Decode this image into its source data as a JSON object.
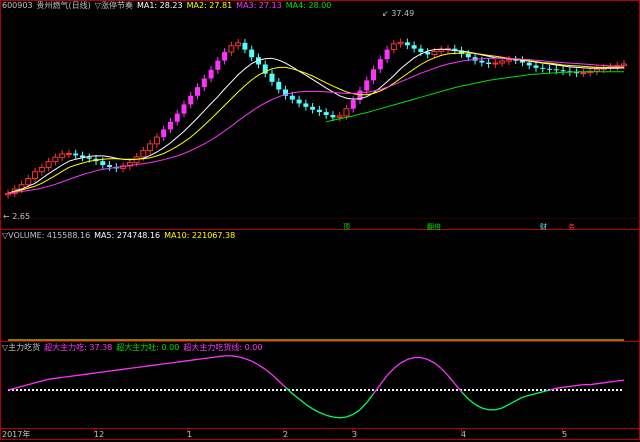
{
  "main_header": {
    "code": "600903",
    "name": "贵州燃气(日线)",
    "indicator": "▽涨停节奏",
    "ma1_label": "MA1: 28.23",
    "ma2_label": "MA2: 27.81",
    "ma3_label": "MA3: 27.13",
    "ma4_label": "MA4: 28.00"
  },
  "volume_header": {
    "name": "▽VOLUME: 415588.16",
    "ma5_label": "MA5: 274748.16",
    "ma10_label": "MA10: 221067.38"
  },
  "indicator_header": {
    "name": "▽主力吃货",
    "s1_label": "超大主力吃: 37.38",
    "s2_label": "超大主力吐: 0.00",
    "s3_label": "超大主力吃货线: 0.00"
  },
  "annotations": {
    "high": "37.49",
    "low": "2.65"
  },
  "markers": [
    "顶",
    "翻倍",
    "财",
    "务"
  ],
  "x_labels": [
    "2017年",
    "12",
    "1",
    "2",
    "3",
    "4",
    "5"
  ],
  "colors": {
    "up": "#ff3232",
    "down": "#54ffff",
    "limit_up": "#ff33ff",
    "ma1": "#ffffff",
    "ma2": "#ffff00",
    "ma3": "#ff33ff",
    "ma4": "#00e000",
    "frame": "#b40000"
  },
  "chart_data": [
    {
      "type": "candlestick",
      "title": "贵州燃气(日线)",
      "ylim": [
        -2,
        40
      ],
      "series": [
        {
          "name": "price",
          "values": [
            2.7,
            3.6,
            4.5,
            5.8,
            7.2,
            8.1,
            9.3,
            10.2,
            10.9,
            11.0,
            10.6,
            10.2,
            9.9,
            9.4,
            8.6,
            8.2,
            7.9,
            8.4,
            9.1,
            10.3,
            11.6,
            13.0,
            14.4,
            16.0,
            17.6,
            19.3,
            21.2,
            23.0,
            24.8,
            26.6,
            28.4,
            30.3,
            32.1,
            33.4,
            34.0,
            32.6,
            31.0,
            29.5,
            27.6,
            25.9,
            24.3,
            23.0,
            22.2,
            21.4,
            20.7,
            20.1,
            19.6,
            19.0,
            18.5,
            18.8,
            20.3,
            22.1,
            24.1,
            26.2,
            28.5,
            30.6,
            32.6,
            33.8,
            34.1,
            33.5,
            32.8,
            32.1,
            31.6,
            32.2,
            32.6,
            32.8,
            32.4,
            31.7,
            31.0,
            30.3,
            29.9,
            29.6,
            29.8,
            30.2,
            30.5,
            30.4,
            29.9,
            29.3,
            28.8,
            28.6,
            28.5,
            28.3,
            28.1,
            27.9,
            27.7,
            27.8,
            28.1,
            28.5,
            28.8,
            29.0,
            29.3,
            29.6
          ]
        },
        {
          "name": "MA1",
          "values": [
            2.7,
            3.2,
            3.6,
            4.2,
            4.8,
            5.8,
            6.8,
            7.7,
            8.6,
            9.4,
            9.8,
            10.1,
            10.4,
            10.5,
            10.5,
            10.3,
            10.0,
            9.8,
            9.7,
            9.8,
            10.0,
            10.6,
            11.3,
            12.2,
            13.2,
            14.4,
            15.6,
            17.0,
            18.4,
            19.9,
            21.4,
            22.8,
            24.4,
            25.9,
            27.4,
            28.6,
            29.7,
            30.4,
            30.7,
            30.8,
            30.4,
            29.8,
            29.0,
            28.1,
            27.3,
            26.4,
            25.5,
            24.6,
            23.8,
            23.0,
            22.5,
            22.3,
            22.4,
            22.8,
            23.6,
            24.7,
            25.9,
            27.2,
            28.6,
            29.8,
            30.9,
            31.7,
            32.3,
            32.6,
            32.7,
            32.6,
            32.4,
            32.3,
            32.1,
            31.8,
            31.5,
            31.2,
            30.9,
            30.8,
            30.7,
            30.6,
            30.4,
            30.2,
            30.0,
            29.8,
            29.6,
            29.4,
            29.2,
            29.0,
            28.9,
            28.8,
            28.7,
            28.7,
            28.7,
            28.7,
            28.7,
            28.8
          ]
        },
        {
          "name": "MA2",
          "values": [
            2.7,
            3.1,
            3.4,
            3.8,
            4.2,
            4.8,
            5.6,
            6.4,
            7.3,
            8.1,
            8.6,
            9.0,
            9.4,
            9.6,
            9.8,
            9.9,
            9.9,
            9.8,
            9.8,
            9.8,
            9.9,
            10.1,
            10.5,
            11.0,
            11.7,
            12.5,
            13.4,
            14.4,
            15.6,
            16.9,
            18.2,
            19.6,
            21.0,
            22.4,
            23.8,
            25.1,
            26.3,
            27.3,
            28.0,
            28.6,
            28.9,
            28.9,
            28.6,
            28.2,
            27.7,
            27.1,
            26.4,
            25.7,
            25.0,
            24.4,
            23.8,
            23.4,
            23.2,
            23.2,
            23.5,
            24.0,
            24.7,
            25.6,
            26.6,
            27.6,
            28.6,
            29.5,
            30.3,
            30.9,
            31.4,
            31.7,
            31.8,
            31.9,
            31.9,
            31.8,
            31.6,
            31.4,
            31.2,
            31.0,
            30.8,
            30.6,
            30.5,
            30.3,
            30.1,
            29.9,
            29.8,
            29.6,
            29.4,
            29.3,
            29.2,
            29.1,
            29.0,
            28.9,
            28.9,
            28.9,
            28.9,
            28.9
          ]
        },
        {
          "name": "MA3",
          "values": [
            2.7,
            2.9,
            3.1,
            3.3,
            3.5,
            3.8,
            4.2,
            4.6,
            5.1,
            5.6,
            6.1,
            6.6,
            7.0,
            7.4,
            7.7,
            7.9,
            8.1,
            8.3,
            8.5,
            8.7,
            8.9,
            9.1,
            9.4,
            9.7,
            10.1,
            10.5,
            11.0,
            11.6,
            12.3,
            13.0,
            13.8,
            14.7,
            15.7,
            16.7,
            17.8,
            18.8,
            19.8,
            20.7,
            21.5,
            22.2,
            22.8,
            23.3,
            23.6,
            23.8,
            23.9,
            23.9,
            23.9,
            23.8,
            23.7,
            23.6,
            23.5,
            23.5,
            23.6,
            23.7,
            24.0,
            24.3,
            24.8,
            25.3,
            25.9,
            26.5,
            27.1,
            27.7,
            28.2,
            28.7,
            29.2,
            29.6,
            29.9,
            30.2,
            30.4,
            30.6,
            30.7,
            30.8,
            30.8,
            30.8,
            30.8,
            30.7,
            30.6,
            30.5,
            30.4,
            30.3,
            30.1,
            30.0,
            29.9,
            29.8,
            29.7,
            29.6,
            29.5,
            29.4,
            29.3,
            29.2,
            29.1,
            29.1
          ]
        },
        {
          "name": "MA4",
          "values": [
            null,
            null,
            null,
            null,
            null,
            null,
            null,
            null,
            null,
            null,
            null,
            null,
            null,
            null,
            null,
            null,
            null,
            null,
            null,
            null,
            null,
            null,
            null,
            null,
            null,
            null,
            null,
            null,
            null,
            null,
            null,
            null,
            null,
            null,
            null,
            null,
            null,
            null,
            null,
            null,
            null,
            null,
            null,
            null,
            null,
            null,
            null,
            17.6,
            17.9,
            18.2,
            18.5,
            18.8,
            19.2,
            19.5,
            19.9,
            20.3,
            20.7,
            21.1,
            21.5,
            21.9,
            22.3,
            22.7,
            23.1,
            23.5,
            23.9,
            24.3,
            24.7,
            25.0,
            25.3,
            25.6,
            25.9,
            26.2,
            26.4,
            26.6,
            26.8,
            27.0,
            27.2,
            27.4,
            27.5,
            27.6,
            27.7,
            27.8,
            27.9,
            27.9,
            28.0,
            28.0,
            28.0,
            28.0,
            28.0,
            28.0,
            28.0,
            28.0
          ]
        }
      ]
    },
    {
      "type": "bar",
      "title": "VOLUME",
      "ylim": [
        0,
        500000
      ],
      "series": [
        {
          "name": "VOLUME",
          "values": [
            0,
            0,
            0,
            0,
            0,
            0,
            0,
            0,
            0,
            0,
            0,
            0,
            0,
            0,
            0,
            0,
            0,
            0,
            0,
            0,
            0,
            0,
            0,
            0,
            0,
            0,
            0,
            0,
            0,
            0,
            0,
            0,
            0,
            0,
            0,
            0,
            0,
            0,
            0,
            0,
            0,
            0,
            0,
            0,
            0,
            0,
            0,
            0,
            0,
            0,
            0,
            0,
            0,
            0,
            0,
            0,
            0,
            0,
            0,
            0,
            0,
            0,
            0,
            0,
            0,
            0,
            0,
            0,
            0,
            0,
            0,
            0,
            0,
            0,
            0,
            0,
            0,
            0,
            0,
            0,
            0,
            0,
            0,
            0,
            0,
            0,
            0,
            0,
            0,
            0,
            0,
            0
          ]
        },
        {
          "name": "MA5",
          "values": [
            0,
            0,
            0,
            0,
            0,
            0,
            0,
            0,
            0,
            0,
            0,
            0,
            0,
            0,
            0,
            0,
            0,
            0,
            0,
            0,
            0,
            0,
            0,
            0,
            0,
            0,
            0,
            0,
            0,
            0,
            0,
            0,
            0,
            0,
            0,
            0,
            0,
            0,
            0,
            0,
            0,
            0,
            0,
            0,
            0,
            0,
            0,
            0,
            0,
            0,
            0,
            0,
            0,
            0,
            0,
            0,
            0,
            0,
            0,
            0,
            0,
            0,
            0,
            0,
            0,
            0,
            0,
            0,
            0,
            0,
            0,
            0,
            0,
            0,
            0,
            0,
            0,
            0,
            0,
            0,
            0,
            0,
            0,
            0,
            0,
            0,
            0,
            0,
            0,
            0,
            0,
            0
          ]
        },
        {
          "name": "MA10",
          "values": [
            0,
            0,
            0,
            0,
            0,
            0,
            0,
            0,
            0,
            0,
            0,
            0,
            0,
            0,
            0,
            0,
            0,
            0,
            0,
            0,
            0,
            0,
            0,
            0,
            0,
            0,
            0,
            0,
            0,
            0,
            0,
            0,
            0,
            0,
            0,
            0,
            0,
            0,
            0,
            0,
            0,
            0,
            0,
            0,
            0,
            0,
            0,
            0,
            0,
            0,
            0,
            0,
            0,
            0,
            0,
            0,
            0,
            0,
            0,
            0,
            0,
            0,
            0,
            0,
            0,
            0,
            0,
            0,
            0,
            0,
            0,
            0,
            0,
            0,
            0,
            0,
            0,
            0,
            0,
            0,
            0,
            0,
            0,
            0,
            0,
            0,
            0,
            0,
            0,
            0,
            0,
            0
          ]
        }
      ]
    },
    {
      "type": "line",
      "title": "主力吃货",
      "ylim": [
        -40,
        40
      ],
      "series": [
        {
          "name": "超大主力吃",
          "values": [
            0,
            2,
            4,
            6,
            8,
            10,
            12,
            13,
            14,
            15,
            16,
            17,
            18,
            19,
            20,
            21,
            22,
            23,
            24,
            25,
            26,
            27,
            28,
            29,
            30,
            31,
            32,
            33,
            34,
            35,
            36,
            37,
            38,
            38,
            37,
            35,
            32,
            28,
            23,
            17,
            10,
            3,
            -4,
            -10,
            -16,
            -21,
            -25,
            -28,
            -30,
            -31,
            -30,
            -27,
            -22,
            -14,
            -4,
            6,
            16,
            24,
            30,
            34,
            36,
            36,
            34,
            30,
            24,
            16,
            7,
            -2,
            -10,
            -16,
            -20,
            -22,
            -22,
            -20,
            -16,
            -12,
            -8,
            -6,
            -4,
            -2,
            0,
            2,
            3,
            4,
            5,
            6,
            6,
            7,
            8,
            9,
            10,
            11
          ]
        },
        {
          "name": "超大主力吐",
          "values": [
            0,
            0,
            0,
            0,
            0,
            0,
            0,
            0,
            0,
            0,
            0,
            0,
            0,
            0,
            0,
            0,
            0,
            0,
            0,
            0,
            0,
            0,
            0,
            0,
            0,
            0,
            0,
            0,
            0,
            0,
            0,
            0,
            0,
            0,
            0,
            0,
            0,
            0,
            0,
            0,
            0,
            0,
            0,
            0,
            0,
            0,
            0,
            0,
            0,
            0,
            0,
            0,
            0,
            0,
            0,
            0,
            0,
            0,
            0,
            0,
            0,
            0,
            0,
            0,
            0,
            0,
            0,
            0,
            0,
            0,
            0,
            0,
            0,
            0,
            0,
            0,
            0,
            0,
            0,
            0,
            0,
            0,
            0,
            0,
            0,
            0,
            0,
            0,
            0,
            0,
            0,
            0
          ]
        },
        {
          "name": "超大主力吃货线",
          "values": [
            0,
            0,
            0,
            0,
            0,
            0,
            0,
            0,
            0,
            0,
            0,
            0,
            0,
            0,
            0,
            0,
            0,
            0,
            0,
            0,
            0,
            0,
            0,
            0,
            0,
            0,
            0,
            0,
            0,
            0,
            0,
            0,
            0,
            0,
            0,
            0,
            0,
            0,
            0,
            0,
            0,
            0,
            0,
            0,
            0,
            0,
            0,
            0,
            0,
            0,
            0,
            0,
            0,
            0,
            0,
            0,
            0,
            0,
            0,
            0,
            0,
            0,
            0,
            0,
            0,
            0,
            0,
            0,
            0,
            0,
            0,
            0,
            0,
            0,
            0,
            0,
            0,
            0,
            0,
            0,
            0,
            0,
            0,
            0,
            0,
            0,
            0,
            0,
            0,
            0,
            0,
            0
          ]
        }
      ]
    }
  ]
}
